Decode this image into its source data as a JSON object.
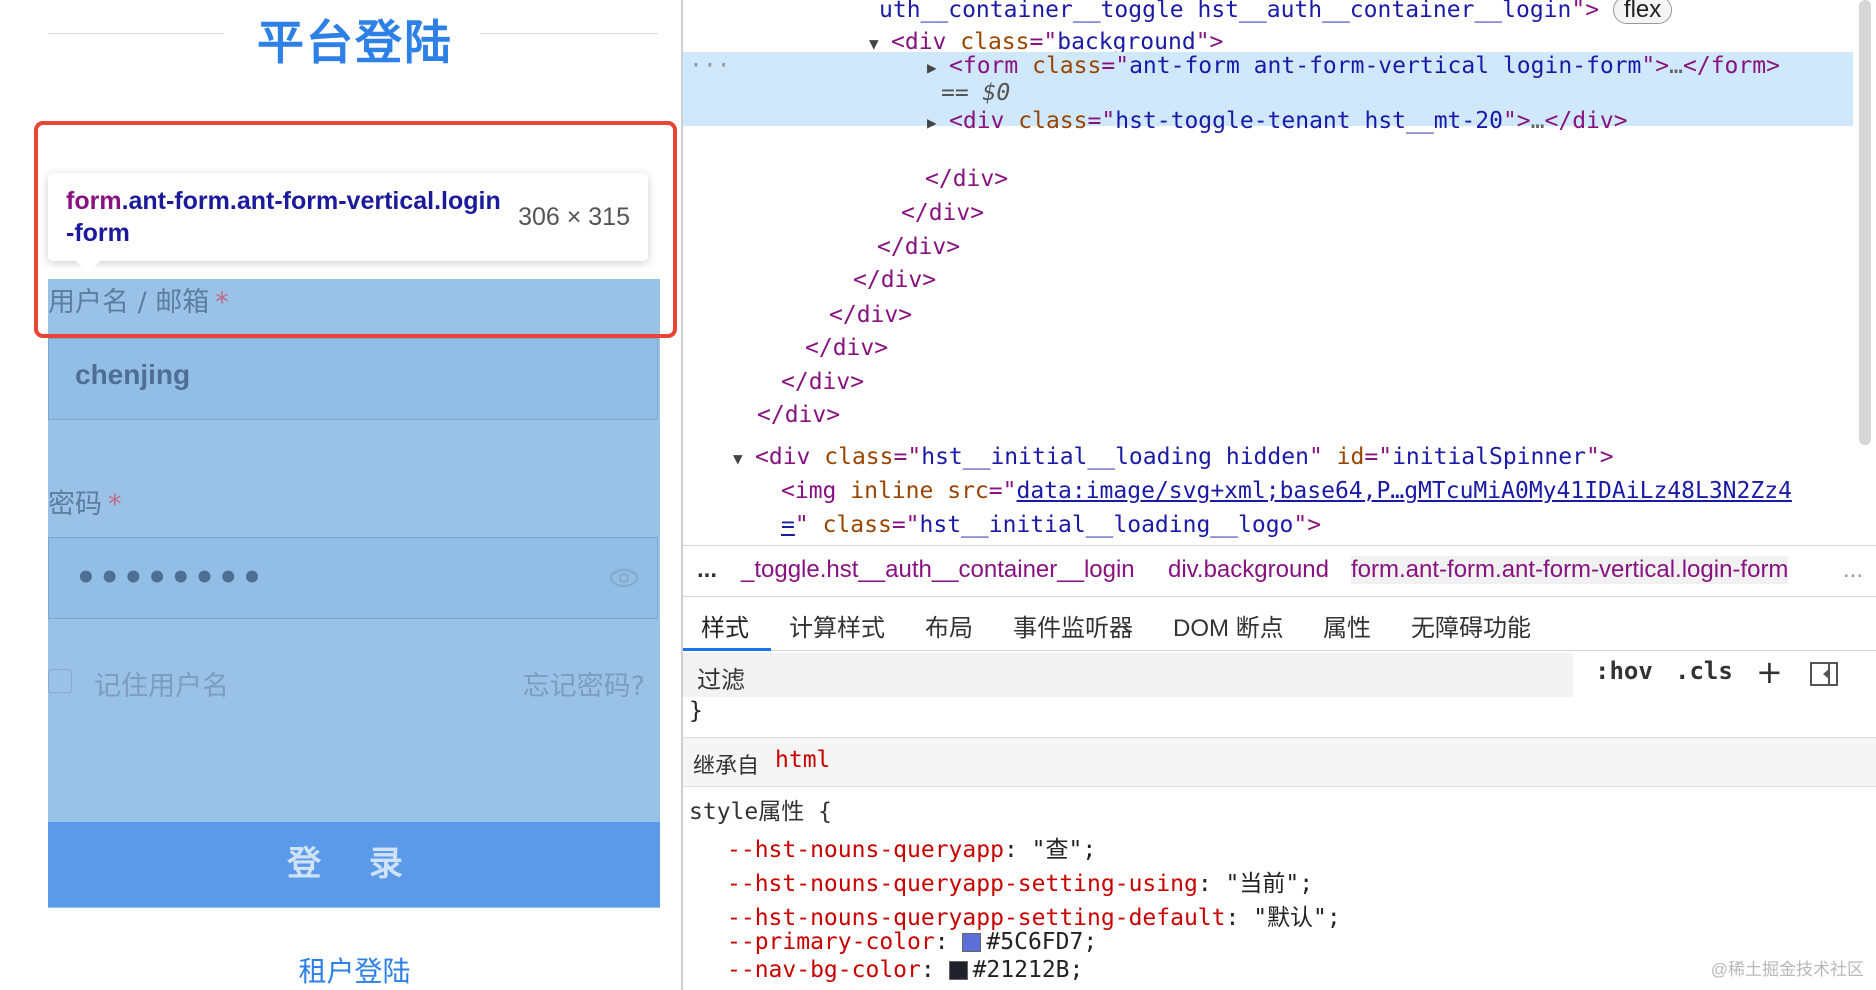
{
  "preview": {
    "title": "平台登陆",
    "username_label": "用户名 / 邮箱",
    "password_label": "密码",
    "required_mark": "*",
    "username_value": "chenjing",
    "password_dots": "••••••••",
    "remember_label": "记住用户名",
    "forgot_label": "忘记密码?",
    "login_label": "登 录",
    "tenant_link": "租户登陆",
    "tooltip": {
      "tag": "form",
      "classes": ".ant-form.ant-form-vertical.login-form",
      "size": "306 × 315"
    }
  },
  "dom": {
    "line0": {
      "a": "uth__container__toggle hst__auth__container__login",
      "pill": "flex"
    },
    "line1": {
      "tag": "div",
      "attr": "class",
      "val": "background"
    },
    "line2": {
      "tag": "form",
      "attr": "class",
      "val": "ant-form ant-form-vertical login-form",
      "ellipsis": "…",
      "close": "form"
    },
    "line2b": "== $0",
    "dots": "···",
    "line3": {
      "tag": "div",
      "attr": "class",
      "val": "hst-toggle-tenant hst__mt-20",
      "ellipsis": "…",
      "close": "div"
    },
    "close_div": "div",
    "line11": {
      "tag": "div",
      "attr": "class",
      "val": "hst__initial__loading hidden",
      "attr2": "id",
      "val2": "initialSpinner"
    },
    "line12": {
      "tag": "img",
      "attr0": "inline",
      "attr": "src",
      "val": "data:image/svg+xml;base64,P…gMTcuMiA0My41IDAiLz48L3N2Zz4"
    },
    "line13": {
      "val_tail": "=",
      "attr": "class",
      "val": "hst__initial__loading__logo"
    }
  },
  "breadcrumbs": {
    "more": "...",
    "items": [
      "_toggle.hst__auth__container__login",
      "div.background",
      "form.ant-form.ant-form-vertical.login-form"
    ],
    "more_right": "..."
  },
  "tabs": [
    "样式",
    "计算样式",
    "布局",
    "事件监听器",
    "DOM 断点",
    "属性",
    "无障碍功能"
  ],
  "styles": {
    "filter_placeholder": "过滤",
    "hov": ":hov",
    "cls": ".cls",
    "plus": "+",
    "closing_brace": "}",
    "inherited_label": "继承自",
    "inherited_tag": "html",
    "style_attr": "style属性 {",
    "props": [
      {
        "name": "--hst-nouns-queryapp",
        "value": "\"查\";"
      },
      {
        "name": "--hst-nouns-queryapp-setting-using",
        "value": "\"当前\";"
      },
      {
        "name": "--hst-nouns-queryapp-setting-default",
        "value": "\"默认\";"
      },
      {
        "name": "--primary-color",
        "value": "#5C6FD7;",
        "swatch": "#5C6FD7"
      },
      {
        "name": "--nav-bg-color",
        "value": "#21212B;",
        "swatch": "#21212B"
      }
    ]
  },
  "watermark": "@稀土掘金技术社区",
  "colors": {
    "highlight_border": "#e94535",
    "accent_blue": "#2d80e6",
    "selected_row": "#cfe8fc"
  }
}
